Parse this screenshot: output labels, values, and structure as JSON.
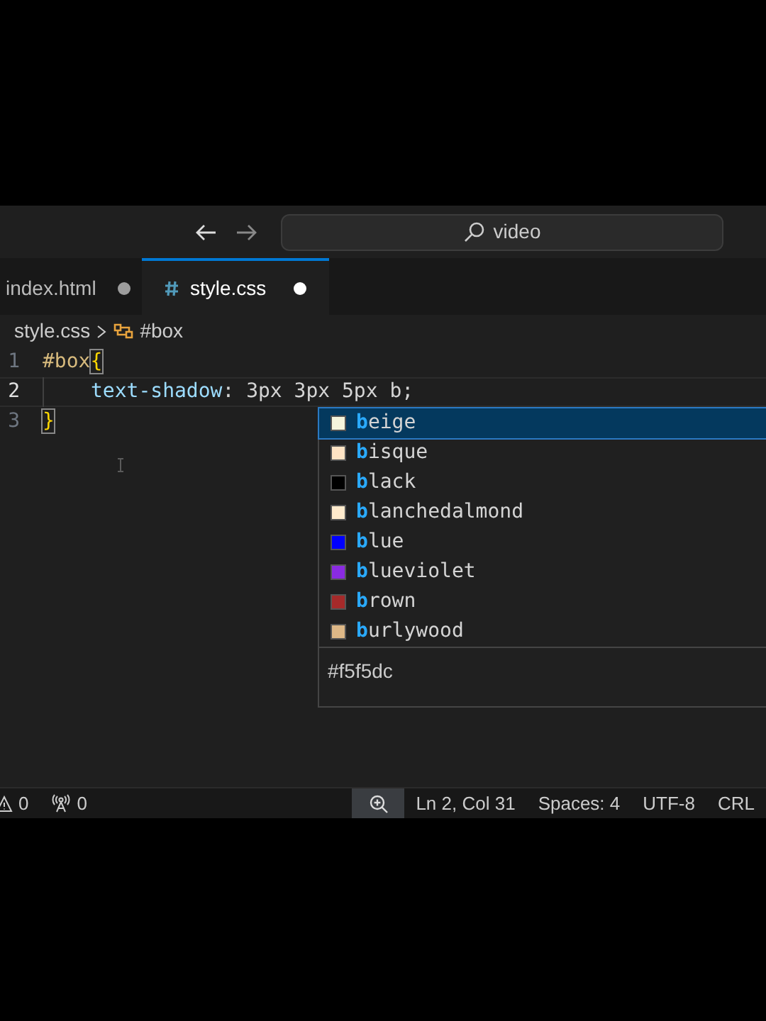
{
  "title_bar": {
    "search": {
      "value": "video"
    }
  },
  "tabs": [
    {
      "label": "index.html",
      "selected": false,
      "dirty": true,
      "kind": "html"
    },
    {
      "label": "style.css",
      "selected": true,
      "dirty": true,
      "kind": "css"
    }
  ],
  "breadcrumb": [
    {
      "label": "style.css",
      "kind": "file"
    },
    {
      "label": "#box",
      "kind": "symbol"
    }
  ],
  "editor": {
    "lines": [
      {
        "number": "1",
        "current": false,
        "indent": false,
        "tokens": [
          {
            "text": "#box",
            "kind": "selector"
          },
          {
            "text": "{",
            "kind": "bracket"
          }
        ]
      },
      {
        "number": "2",
        "current": true,
        "indent": true,
        "tokens": [
          {
            "text": "text-shadow",
            "kind": "property"
          },
          {
            "text": ": 3px 3px 5px b;",
            "kind": "plain"
          }
        ]
      },
      {
        "number": "3",
        "current": false,
        "indent": false,
        "tokens": [
          {
            "text": "}",
            "kind": "bracket"
          }
        ]
      }
    ]
  },
  "suggestions": {
    "items": [
      {
        "match": "b",
        "rest": "eige",
        "color": "#f5f5dc",
        "selected": true
      },
      {
        "match": "b",
        "rest": "isque",
        "color": "#ffe4c4",
        "selected": false
      },
      {
        "match": "b",
        "rest": "lack",
        "color": "#000000",
        "selected": false
      },
      {
        "match": "b",
        "rest": "lanchedalmond",
        "color": "#ffebcd",
        "selected": false
      },
      {
        "match": "b",
        "rest": "lue",
        "color": "#0000ff",
        "selected": false
      },
      {
        "match": "b",
        "rest": "lueviolet",
        "color": "#8a2be2",
        "selected": false
      },
      {
        "match": "b",
        "rest": "rown",
        "color": "#a52a2a",
        "selected": false
      },
      {
        "match": "b",
        "rest": "urlywood",
        "color": "#deb887",
        "selected": false
      }
    ],
    "detail": "#f5f5dc"
  },
  "status_bar": {
    "left": [
      {
        "kind": "warnings",
        "count": "0"
      },
      {
        "kind": "ports",
        "count": "0"
      }
    ],
    "right": [
      "Ln 2, Col 31",
      "Spaces: 4",
      "UTF-8",
      "CRL"
    ]
  }
}
